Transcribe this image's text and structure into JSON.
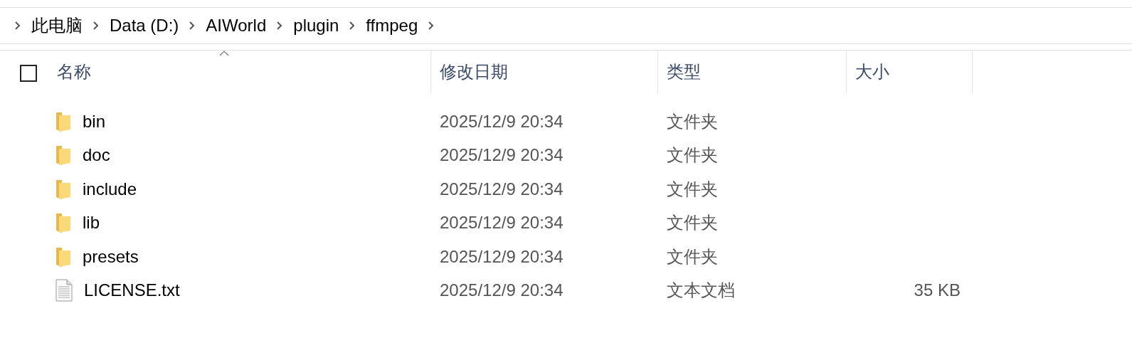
{
  "breadcrumb": [
    "此电脑",
    "Data (D:)",
    "AIWorld",
    "plugin",
    "ffmpeg"
  ],
  "table": {
    "select_all": {
      "checked": false
    },
    "columns": [
      "名称",
      "修改日期",
      "类型",
      "大小"
    ],
    "rows": [
      {
        "kind": "folder",
        "name": "bin",
        "date": "2025/12/9 20:34",
        "type": "文件夹"
      },
      {
        "kind": "folder",
        "name": "doc",
        "date": "2025/12/9 20:34",
        "type": "文件夹"
      },
      {
        "kind": "folder",
        "name": "include",
        "date": "2025/12/9 20:34",
        "type": "文件夹"
      },
      {
        "kind": "folder",
        "name": "lib",
        "date": "2025/12/9 20:34",
        "type": "文件夹"
      },
      {
        "kind": "folder",
        "name": "presets",
        "date": "2025/12/9 20:34",
        "type": "文件夹"
      },
      {
        "kind": "file",
        "name": "LICENSE.txt",
        "date": "2025/12/9 20:34",
        "type": "文本文档",
        "size": "35 KB"
      }
    ]
  }
}
